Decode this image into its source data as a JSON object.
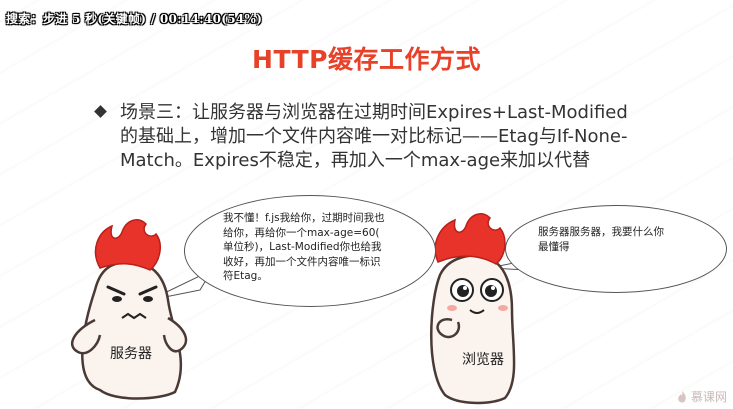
{
  "overlay": {
    "text": "搜索：步进 5 秒(关键帧) / 00:14:40(54%)"
  },
  "slide": {
    "title": "HTTP缓存工作方式",
    "bullet_line1": "场景三：让服务器与浏览器在过期时间Expires+Last-Modified",
    "bullet_line2": "的基础上，增加一个文件内容唯一对比标记——Etag与If-None-",
    "bullet_line3": "Match。Expires不稳定，再加入一个max-age来加以代替"
  },
  "bubbles": {
    "server_line1": "我不懂！f.js我给你，过期时间我也",
    "server_line2": "给你，再给你一个max-age=60(",
    "server_line3": "单位秒)，Last-Modified你也给我",
    "server_line4": "收好，再加一个文件内容唯一标识",
    "server_line5": "符Etag。",
    "browser_line1": "服务器服务器，我要什么你",
    "browser_line2": "最懂得"
  },
  "characters": {
    "server_label": "服务器",
    "browser_label": "浏览器"
  },
  "logo": {
    "text": "慕课网",
    "icon": "flame-logo-icon"
  },
  "colors": {
    "title": "#e8412a",
    "flame": "#e8332a",
    "body_text": "#333333"
  }
}
